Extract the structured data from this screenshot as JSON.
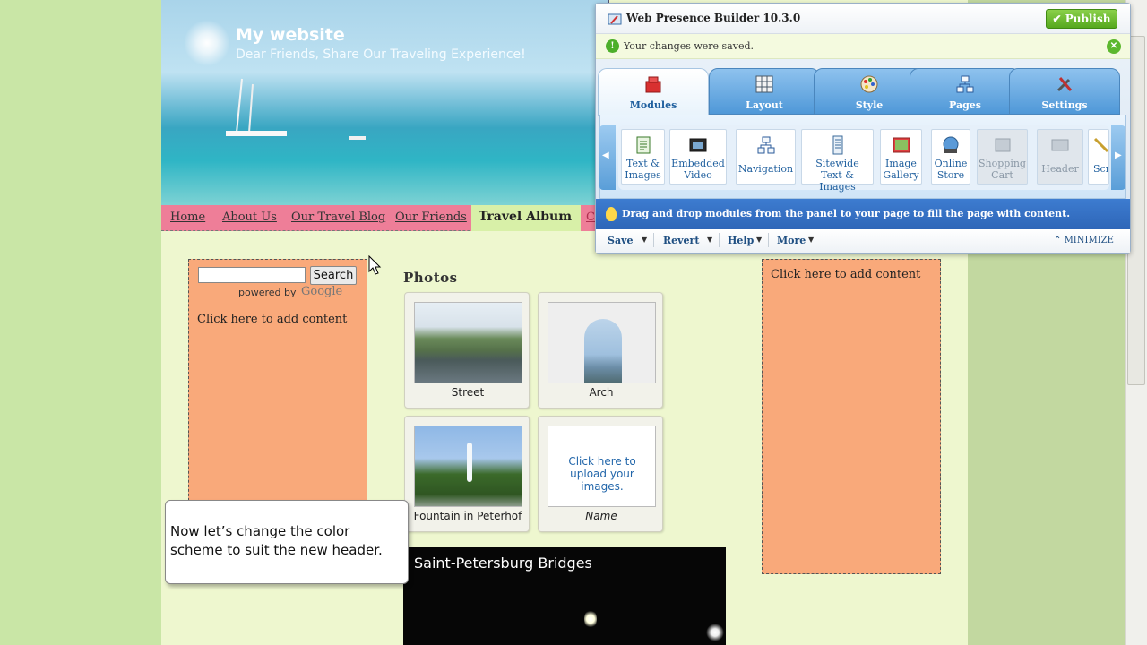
{
  "site": {
    "title": "My website",
    "subtitle": "Dear Friends, Share Our Traveling Experience!",
    "nav": [
      "Home",
      "About Us",
      "Our Travel Blog",
      "Our Friends",
      "Travel Album"
    ],
    "nav_active": "Travel Album",
    "nav_partial": "C"
  },
  "left_column": {
    "search_button": "Search",
    "search_placeholder": "",
    "powered_by": "powered by",
    "google": "Google",
    "add_content": "Click here to add content"
  },
  "right_column": {
    "add_content": "Click here to add content"
  },
  "photos": {
    "title": "Photos",
    "items": [
      "Street",
      "Arch",
      "Fountain in Peterhof"
    ],
    "upload_text": "Click here to upload your images.",
    "upload_name": "Name"
  },
  "video": {
    "title": "Saint-Petersburg Bridges"
  },
  "tooltip": {
    "text": "Now let’s change the color scheme to suit the new header."
  },
  "builder": {
    "title": "Web Presence Builder 10.3.0",
    "publish": "Publish",
    "saved_message": "Your changes were saved.",
    "tabs": [
      "Modules",
      "Layout",
      "Style",
      "Pages",
      "Settings"
    ],
    "modules": [
      {
        "line1": "Text &",
        "line2": "Images"
      },
      {
        "line1": "Embedded",
        "line2": "Video"
      },
      {
        "line1": "Navigation",
        "line2": ""
      },
      {
        "line1": "Sitewide",
        "line2": "Text & Images"
      },
      {
        "line1": "Image",
        "line2": "Gallery"
      },
      {
        "line1": "Online",
        "line2": "Store"
      },
      {
        "line1": "Shopping",
        "line2": "Cart"
      },
      {
        "line1": "Header",
        "line2": ""
      },
      {
        "line1": "Scr",
        "line2": ""
      }
    ],
    "hint": "Drag and drop modules from the panel to your page to fill the page with content.",
    "menu": [
      "Save",
      "Revert",
      "Help",
      "More"
    ],
    "minimize": "MINIMIZE"
  },
  "colors": {
    "nav_pink": "#ee7e98",
    "column_orange": "#f9a97a",
    "publish_green": "#56a81e",
    "hint_blue": "#2e66b8"
  }
}
